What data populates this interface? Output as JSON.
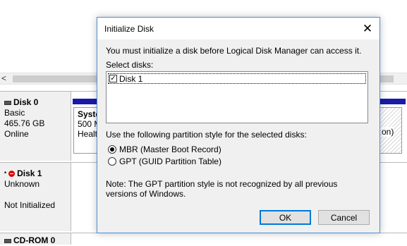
{
  "background": {
    "scroll_left_arrow": "<",
    "disks": [
      {
        "name": "Disk 0",
        "lines": [
          "Basic",
          "465.76 GB",
          "Online"
        ],
        "icon": "disk-icon"
      },
      {
        "name": "Disk 1",
        "lines": [
          "Unknown",
          "",
          "Not Initialized"
        ],
        "icon": "error-icon",
        "mark": "*"
      },
      {
        "name": "CD-ROM 0"
      }
    ],
    "partition_left": [
      "Syste",
      "500 M",
      "Healt"
    ],
    "partition_right": "on)"
  },
  "dialog": {
    "title": "Initialize Disk",
    "close_glyph": "✕",
    "intro": "You must initialize a disk before Logical Disk Manager can access it.",
    "select_label": "Select disks:",
    "disks": [
      {
        "label": "Disk 1",
        "checked": true
      }
    ],
    "style_label": "Use the following partition style for the selected disks:",
    "options": [
      {
        "label": "MBR (Master Boot Record)",
        "selected": true
      },
      {
        "label": "GPT (GUID Partition Table)",
        "selected": false
      }
    ],
    "note": "Note: The GPT partition style is not recognized by all previous versions of Windows.",
    "ok_label": "OK",
    "cancel_label": "Cancel"
  },
  "colors": {
    "accent": "#0078d7",
    "partition_bar": "#1a1aa8",
    "error": "#d00000"
  }
}
